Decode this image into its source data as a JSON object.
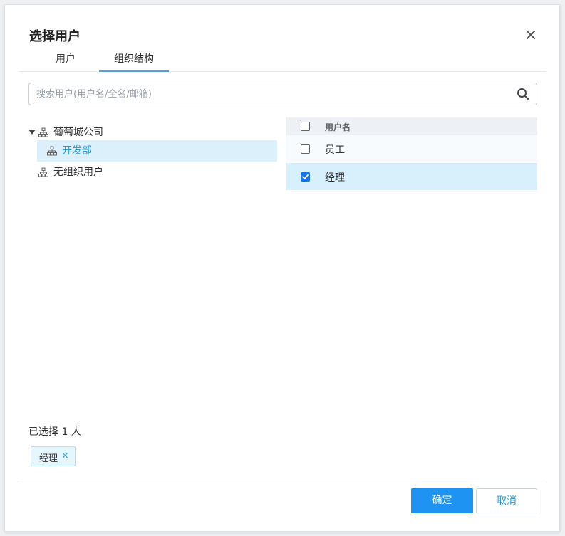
{
  "dialog": {
    "title": "选择用户",
    "close_icon": "close-icon"
  },
  "tabs": [
    {
      "label": "用户",
      "active": false
    },
    {
      "label": "组织结构",
      "active": true
    }
  ],
  "search": {
    "placeholder": "搜索用户(用户名/全名/邮箱)",
    "value": "",
    "icon": "search-icon"
  },
  "tree": {
    "items": [
      {
        "label": "葡萄城公司",
        "icon": "org-chart-icon",
        "expanded": true
      },
      {
        "label": "开发部",
        "icon": "org-chart-icon",
        "selected": true
      },
      {
        "label": "无组织用户",
        "icon": "org-chart-icon"
      }
    ]
  },
  "table": {
    "header": "用户名",
    "rows": [
      {
        "name": "员工",
        "checked": false
      },
      {
        "name": "经理",
        "checked": true
      }
    ]
  },
  "selection": {
    "count_text": "已选择 1 人",
    "chips": [
      {
        "label": "经理",
        "remove": "×"
      }
    ]
  },
  "buttons": {
    "ok": "确定",
    "cancel": "取消"
  },
  "colors": {
    "accent": "#1e93f2",
    "selected_row": "#d8f0fb",
    "link": "#2f9be0"
  }
}
